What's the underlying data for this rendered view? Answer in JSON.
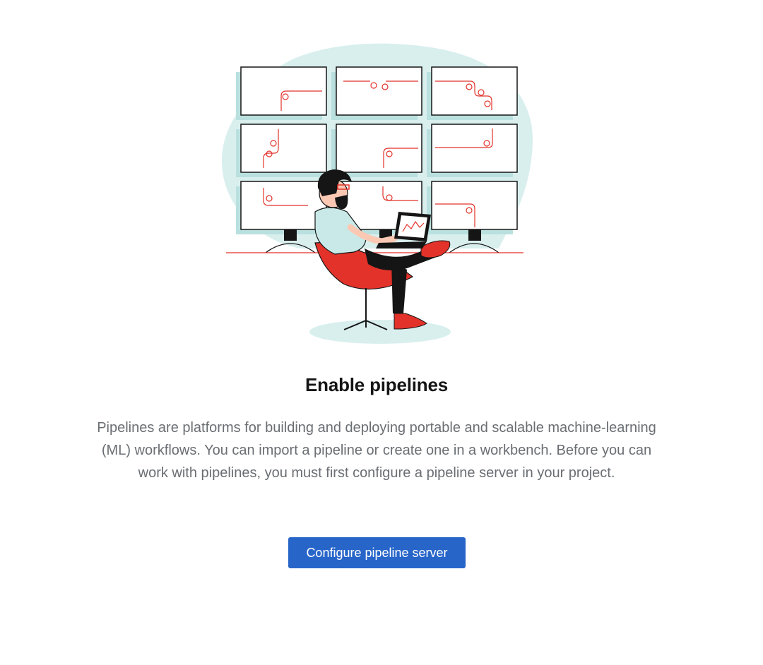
{
  "empty_state": {
    "title": "Enable pipelines",
    "body": "Pipelines are platforms for building and deploying portable and scalable machine-learning (ML) workflows. You can import a pipeline or create one in a workbench. Before you can work with pipelines, you must first configure a pipeline server in your project.",
    "primary_action_label": "Configure pipeline server"
  },
  "illustration": {
    "icon": "person-with-laptop-and-monitor-wall-illustration"
  },
  "colors": {
    "accent": "#2765c9",
    "illustration_red": "#e2322a",
    "illustration_teal": "#d9efee",
    "title": "#151515",
    "body": "#6a6e73"
  }
}
